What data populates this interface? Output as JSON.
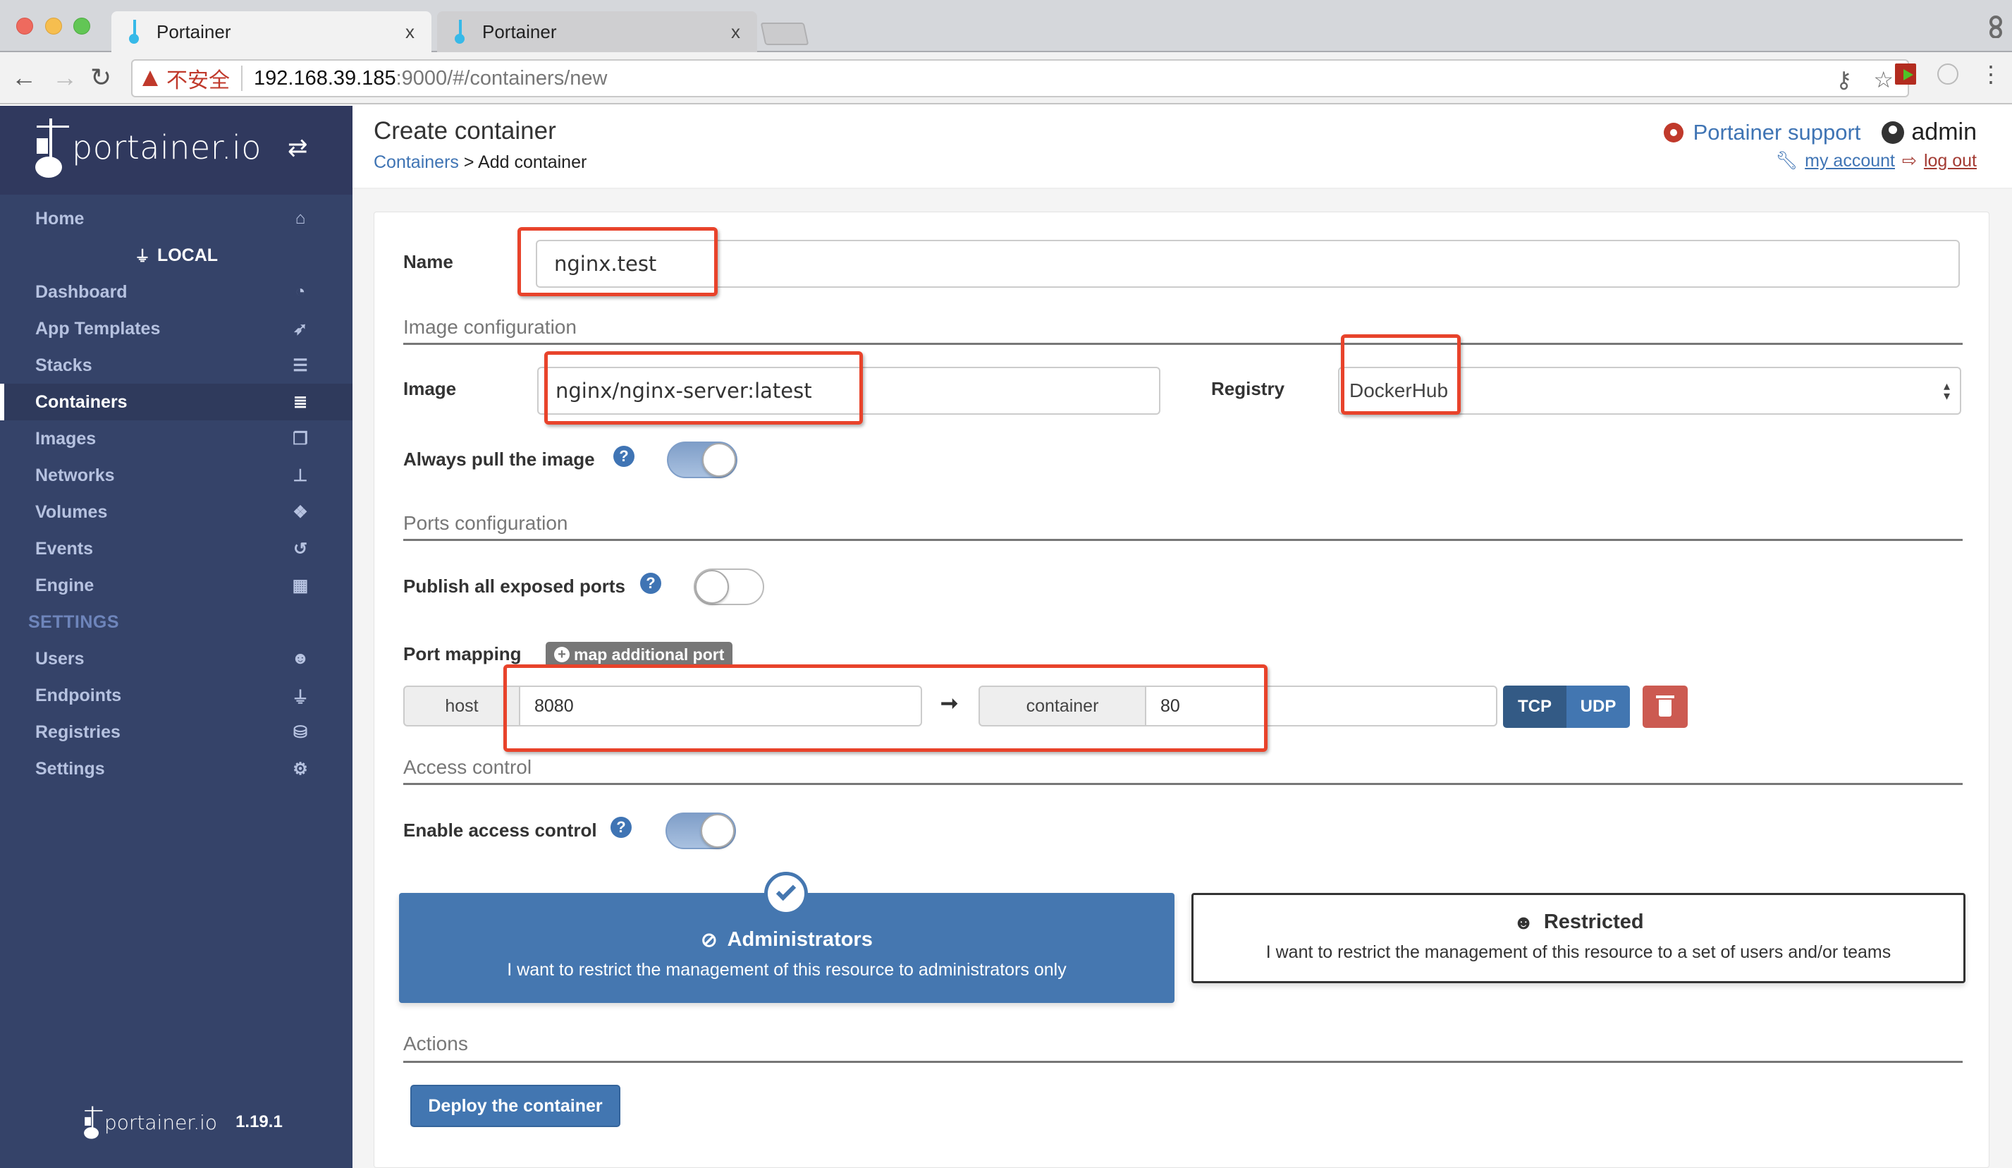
{
  "browser": {
    "tabs": [
      {
        "title": "Portainer",
        "close": "x",
        "active": true
      },
      {
        "title": "Portainer",
        "close": "x",
        "active": false
      }
    ],
    "nav": {
      "back": "←",
      "forward": "→",
      "reload": "↻"
    },
    "address": {
      "security_warning": "不安全",
      "url_host": "192.168.39.185",
      "url_rest": ":9000/#/containers/new"
    },
    "omnibox_icons": [
      "key-icon",
      "star-icon"
    ],
    "extension_icons": [
      "flash-extension-icon",
      "tube-extension-icon",
      "menu-icon"
    ]
  },
  "sidebar": {
    "brand": "portainer.io",
    "endpoint": "LOCAL",
    "items_top": [
      {
        "label": "Home",
        "icon": "home-icon",
        "glyph": "⌂"
      }
    ],
    "items_endpoint": [
      {
        "label": "Dashboard",
        "icon": "dashboard-icon",
        "glyph": "◔"
      },
      {
        "label": "App Templates",
        "icon": "rocket-icon",
        "glyph": "➶"
      },
      {
        "label": "Stacks",
        "icon": "list-icon",
        "glyph": "☰"
      },
      {
        "label": "Containers",
        "icon": "server-icon",
        "glyph": "≣",
        "active": true
      },
      {
        "label": "Images",
        "icon": "clone-icon",
        "glyph": "❐"
      },
      {
        "label": "Networks",
        "icon": "sitemap-icon",
        "glyph": "⊥"
      },
      {
        "label": "Volumes",
        "icon": "cubes-icon",
        "glyph": "❖"
      },
      {
        "label": "Events",
        "icon": "history-icon",
        "glyph": "↺"
      },
      {
        "label": "Engine",
        "icon": "th-icon",
        "glyph": "▦"
      }
    ],
    "settings_title": "SETTINGS",
    "items_settings": [
      {
        "label": "Users",
        "icon": "users-icon",
        "glyph": "☻"
      },
      {
        "label": "Endpoints",
        "icon": "plug-icon",
        "glyph": "⏚"
      },
      {
        "label": "Registries",
        "icon": "database-icon",
        "glyph": "⛁"
      },
      {
        "label": "Settings",
        "icon": "cogs-icon",
        "glyph": "⚙"
      }
    ],
    "footer_brand": "portainer.io",
    "version": "1.19.1"
  },
  "header": {
    "title": "Create container",
    "breadcrumb_link": "Containers",
    "breadcrumb_sep": " > ",
    "breadcrumb_current": "Add container",
    "support_label": "Portainer support",
    "username": "admin",
    "my_account_label": " my account ",
    "logout_label": " log out"
  },
  "form": {
    "name_label": "Name",
    "name_value": "nginx.test",
    "image_section": "Image configuration",
    "image_label": "Image",
    "image_value": "nginx/nginx-server:latest",
    "registry_label": "Registry",
    "registry_value": "DockerHub",
    "always_pull_label": "Always pull the image",
    "always_pull": true,
    "ports_section": "Ports configuration",
    "publish_all_label": "Publish all exposed ports",
    "publish_all": false,
    "port_mapping_label": "Port mapping",
    "map_additional_label": "map additional port",
    "port_mappings": [
      {
        "host_label": "host",
        "host_value": "8080",
        "arrow": "➞",
        "container_label": "container",
        "container_value": "80",
        "protocols": [
          "TCP",
          "UDP"
        ],
        "selected_protocol": "TCP"
      }
    ],
    "access_section": "Access control",
    "enable_access_label": "Enable access control",
    "enable_access": true,
    "access_options": [
      {
        "title": "Administrators",
        "icon": "eye-slash-icon",
        "description": "I want to restrict the management of this resource to administrators only",
        "selected": true
      },
      {
        "title": "Restricted",
        "icon": "users-icon",
        "description": "I want to restrict the management of this resource to a set of users and/or teams",
        "selected": false
      }
    ],
    "actions_section": "Actions",
    "deploy_label": "Deploy the container",
    "help_glyph": "?"
  },
  "colors": {
    "sidebar_bg": "#354369",
    "accent_blue": "#4276b1",
    "danger": "#cc5a51",
    "annotation_red": "#e8432b"
  }
}
